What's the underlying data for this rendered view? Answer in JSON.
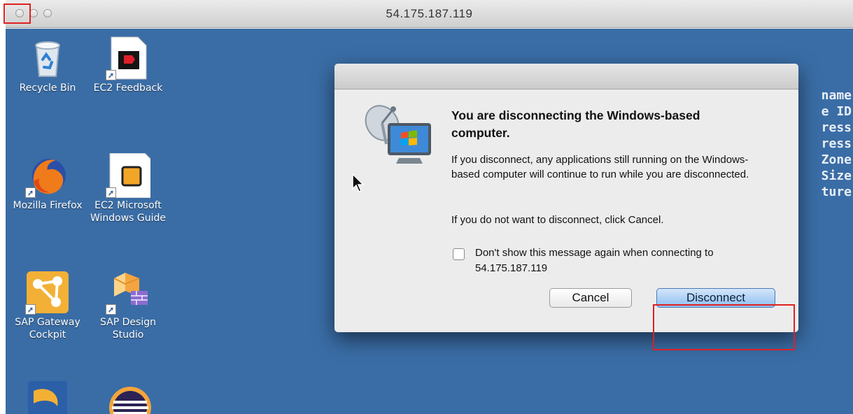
{
  "window": {
    "title": "54.175.187.119"
  },
  "desktop": {
    "icons": [
      {
        "label": "Recycle Bin"
      },
      {
        "label": "EC2 Feedback"
      },
      {
        "label": "Mozilla Firefox"
      },
      {
        "label": "EC2 Microsoft Windows Guide"
      },
      {
        "label": "SAP Gateway Cockpit"
      },
      {
        "label": "SAP Design Studio"
      }
    ],
    "background_text": [
      "name",
      "e ID",
      "ress",
      "ress",
      "Zone",
      "Size",
      "ture"
    ]
  },
  "dialog": {
    "heading": "You are disconnecting the Windows-based computer.",
    "message1": "If you disconnect, any applications still running on the Windows-based computer will continue to run while you are disconnected.",
    "message2": "If you do not want to disconnect, click Cancel.",
    "checkbox_label": "Don't show this message again when connecting to 54.175.187.119",
    "checkbox_checked": false,
    "cancel_label": "Cancel",
    "disconnect_label": "Disconnect"
  },
  "colors": {
    "desktop_bg": "#3a6da6",
    "highlight": "#e02020",
    "default_button": "#8fbdf0"
  }
}
